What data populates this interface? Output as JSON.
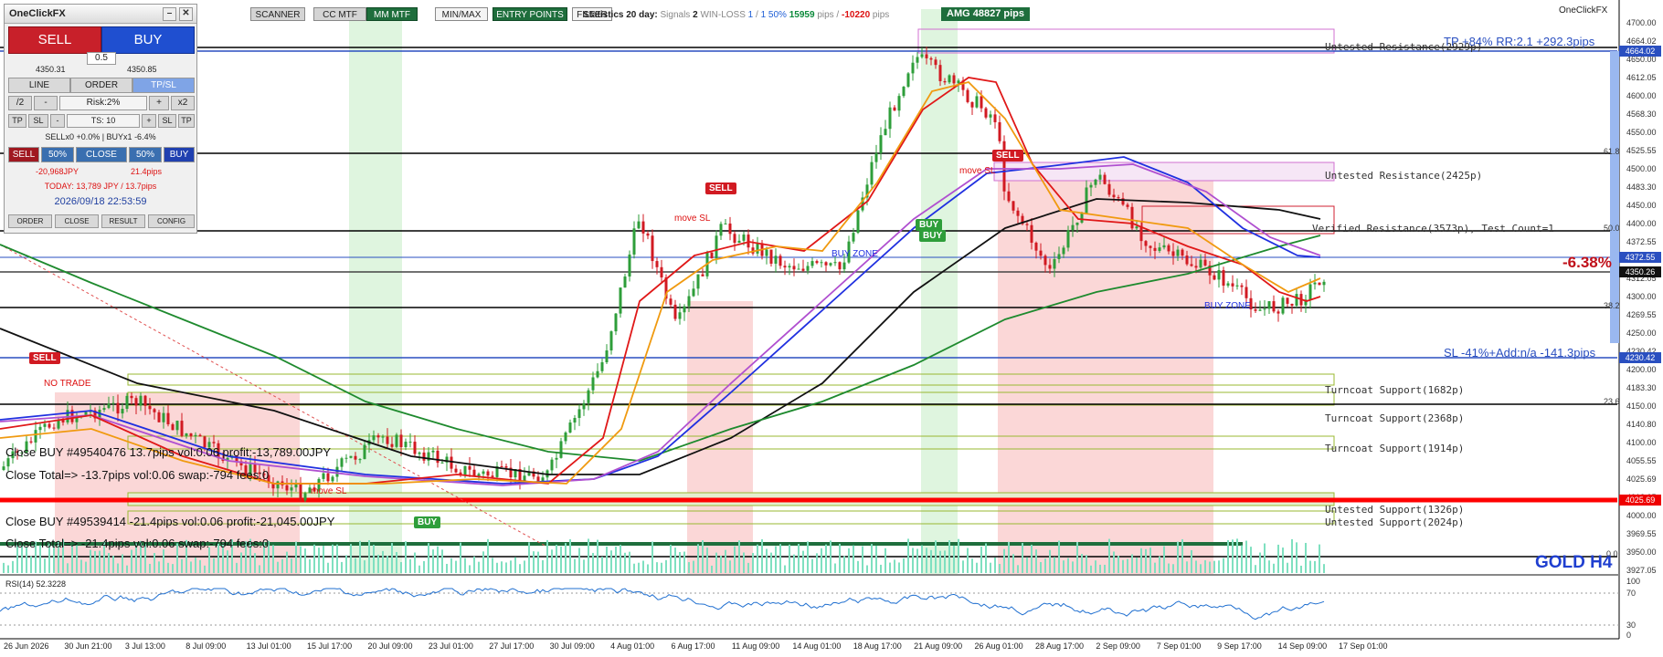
{
  "toolbar": {
    "scanner": "SCANNER",
    "cc_mtf": "CC MTF",
    "mm_mtf": "MM MTF",
    "min_max": "MIN/MAX",
    "entry_points": "ENTRY POINTS",
    "filter": "FILTER"
  },
  "stats": {
    "prefix": "Statistics",
    "days": "20 day:",
    "signals_label": "Signals",
    "signals": "2",
    "winloss_label": "WIN-LOSS",
    "wins": "1",
    "losses": "1",
    "winrate": "50%",
    "pips_win": "15959",
    "pips_unit": "pips /",
    "pips_loss": "-10220",
    "pips_unit2": "pips"
  },
  "amg": "AMG   48827 pips",
  "brand": "OneClickFX",
  "panel": {
    "title": "OneClickFX",
    "sell": "SELL",
    "buy": "BUY",
    "lot": "0.5",
    "bid": "4350.31",
    "ask": "4350.85",
    "tab_line": "LINE",
    "tab_order": "ORDER",
    "tab_tpsl": "TP/SL",
    "div2": "/2",
    "minus": "-",
    "risk": "Risk:2%",
    "plus": "+",
    "x2": "x2",
    "tp": "TP",
    "sl": "SL",
    "minus2": "-",
    "ts": "TS: 10",
    "plus2": "+",
    "sl2": "SL",
    "tp2": "TP",
    "summary": "SELLx0 +0.0% | BUYx1 -6.4%",
    "sell_small": "SELL",
    "p50a": "50%",
    "close": "CLOSE",
    "p50b": "50%",
    "buy_small": "BUY",
    "profit_jpy": "-20,968JPY",
    "profit_pips": "21.4pips",
    "today": "TODAY: 13,789 JPY / 13.7pips",
    "datetime": "2026/09/18   22:53:59",
    "b_order": "ORDER",
    "b_close": "CLOSE",
    "b_result": "RESULT",
    "b_config": "CONFIG"
  },
  "levels": {
    "tp": "TP +84% RR:2.1 +292.3pips",
    "untested_res_1": "Untested Resistance(2929p)",
    "untested_res_2": "Untested Resistance(2425p)",
    "verified_res": "Verified Resistance(3573p), Test Count=1",
    "pct": "-6.38%",
    "sl": "SL -41%+Add:n/a -141.3pips",
    "turncoat_1": "Turncoat Support(1682p)",
    "turncoat_2": "Turncoat Support(2368p)",
    "turncoat_3": "Turncoat Support(1914p)",
    "untested_sup_1": "Untested Support(1326p)",
    "untested_sup_2": "Untested Support(2024p)",
    "gold": "GOLD H4",
    "buy_zone_1": "BUY ZONE",
    "buy_zone_2": "BUY ZONE",
    "no_trade": "NO TRADE",
    "move_sl_1": "move SL",
    "move_sl_2": "move SL",
    "move_sl_3": "move SL",
    "fib_618": "61.8",
    "fib_50": "50.0",
    "fib_382": "38.2",
    "fib_236": "23.6",
    "fib_0": "0.0"
  },
  "close_log": {
    "line1": "Close BUY #49540476 13.7pips vol:0.06 profit:-13,789.00JPY",
    "line2": "Close Total=> -13.7pips vol:0.06 swap:-794 fees:0",
    "line3": "Close BUY #49539414 -21.4pips vol:0.06 profit:-21,045.00JPY",
    "line4": "Close Total=> -21.4pips vol:0.06 swap:-794 fees:0"
  },
  "badges": {
    "sell_1": "SELL",
    "sell_2": "SELL",
    "sell_3": "SELL",
    "buy_1": "BUY",
    "buy_2": "BUY",
    "buy_3": "BUY"
  },
  "price_axis": [
    "4700.00",
    "4664.02",
    "4650.00",
    "4612.05",
    "4600.00",
    "4568.30",
    "4550.00",
    "4525.55",
    "4500.00",
    "4483.30",
    "4450.00",
    "4400.00",
    "4372.55",
    "4350.26",
    "4312.05",
    "4300.00",
    "4269.55",
    "4250.00",
    "4230.42",
    "4200.00",
    "4183.30",
    "4150.00",
    "4140.80",
    "4100.00",
    "4055.55",
    "4025.69",
    "4012.05",
    "4000.00",
    "3969.55",
    "3950.00",
    "3927.05"
  ],
  "price_tags": {
    "tp": "4664.02",
    "cur1": "4372.55",
    "cur2": "4350.26",
    "sl": "4230.42",
    "red": "4025.69"
  },
  "rsi": {
    "label": "RSI(14) 52.3228",
    "t100": "100",
    "t70": "70",
    "t30": "30",
    "t0": "0"
  },
  "date_axis": [
    "26 Jun 2026",
    "30 Jun 21:00",
    "3 Jul 13:00",
    "8 Jul 09:00",
    "13 Jul 01:00",
    "15 Jul 17:00",
    "20 Jul 09:00",
    "23 Jul 01:00",
    "27 Jul 17:00",
    "30 Jul 09:00",
    "4 Aug 01:00",
    "6 Aug 17:00",
    "11 Aug 09:00",
    "14 Aug 01:00",
    "18 Aug 17:00",
    "21 Aug 09:00",
    "26 Aug 01:00",
    "28 Aug 17:00",
    "2 Sep 09:00",
    "7 Sep 01:00",
    "9 Sep 17:00",
    "14 Sep 09:00",
    "17 Sep 01:00"
  ],
  "colors": {
    "sell": "#c8202a",
    "buy": "#1f4fd0",
    "bull_candle": "#2e9e3a",
    "bear_candle": "#d11a22",
    "tp_line": "#2a4fc0",
    "support_red": "#ff0000"
  }
}
